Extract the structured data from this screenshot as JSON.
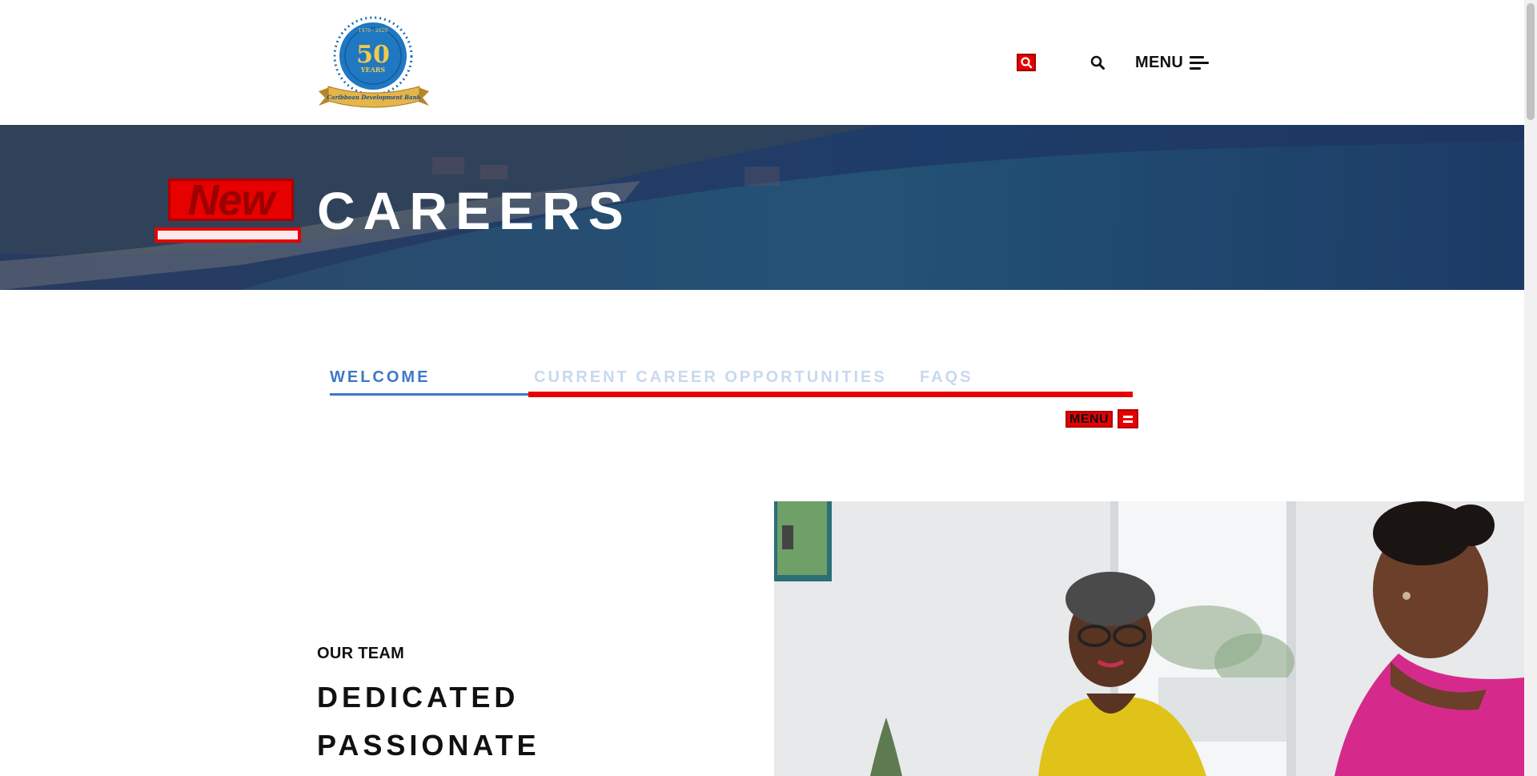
{
  "header": {
    "logo": {
      "top_text": "1970 - 2020",
      "number": "50",
      "years_label": "YEARS",
      "ribbon_text": "Caribbean Development Bank"
    },
    "search_icon": "search-icon",
    "menu_label": "MENU",
    "menu_icon": "hamburger-icon"
  },
  "hero": {
    "badge": "New",
    "title": "CAREERS"
  },
  "tabs": [
    {
      "label": "WELCOME",
      "active": true
    },
    {
      "label": "CURRENT CAREER OPPORTUNITIES",
      "active": false
    },
    {
      "label": "FAQS",
      "active": false
    }
  ],
  "sub_menu": {
    "label": "MENU"
  },
  "team": {
    "eyebrow": "OUR TEAM",
    "words": [
      "DEDICATED",
      "PASSIONATE"
    ]
  },
  "colors": {
    "active_tab": "#3c78c8",
    "inactive_tab": "#c8d8ee",
    "highlight_red": "#e60000",
    "hero_blue": "#244a7a"
  }
}
